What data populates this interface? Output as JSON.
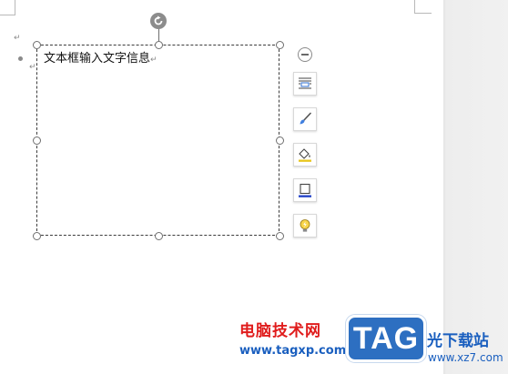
{
  "document": {
    "paragraph_mark": "↵",
    "textbox_text": "文本框输入文字信息"
  },
  "toolbar": {
    "collapse_icon": "minus-circle-icon",
    "items": [
      {
        "name": "layout-options",
        "icon": "text-wrap-icon"
      },
      {
        "name": "shape-style",
        "icon": "paintbrush-icon"
      },
      {
        "name": "fill",
        "icon": "paint-bucket-icon"
      },
      {
        "name": "outline",
        "icon": "outline-icon"
      },
      {
        "name": "smart-tip",
        "icon": "lightbulb-icon"
      }
    ]
  },
  "watermark": {
    "site_name": "电脑技术网",
    "site_url": "www.tagxp.com",
    "logo_text": "TAG",
    "right_text": "光下载站",
    "right_url": "www.xz7.com"
  },
  "colors": {
    "selection_border": "#3c3c3c",
    "rotate_handle": "#8c8c8c",
    "watermark_red": "#e01c1c",
    "watermark_blue": "#1a5fbf",
    "logo_blue": "#2d6fc1"
  }
}
